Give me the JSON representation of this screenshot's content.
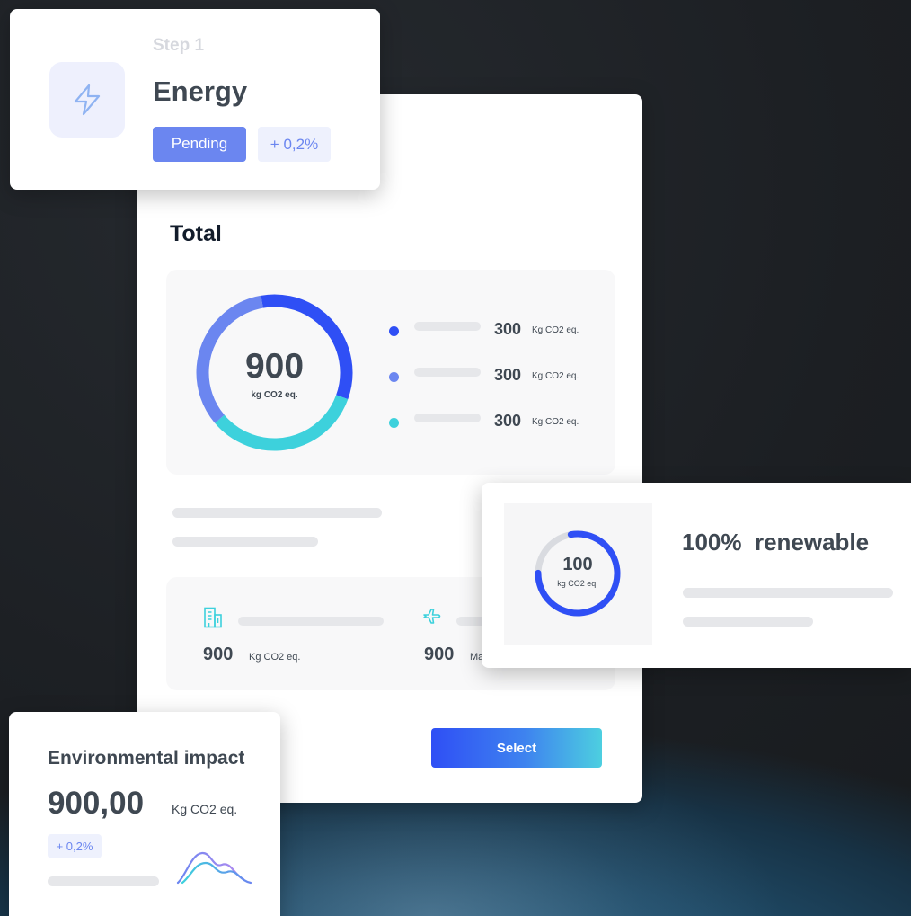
{
  "colors": {
    "accent_blue": "#2f4ff5",
    "periwinkle": "#6b86f0",
    "teal": "#3dd1dc",
    "text_dark": "#3f4852",
    "placeholder": "#e6e7ea"
  },
  "total_card": {
    "title": "Total",
    "donut": {
      "value": "900",
      "unit": "kg CO2 eq.",
      "segments": [
        {
          "share": 0.333,
          "color": "#2f4ff5"
        },
        {
          "share": 0.333,
          "color": "#3dd1dc"
        },
        {
          "share": 0.334,
          "color": "#6b86f0"
        }
      ]
    },
    "legend": [
      {
        "value": "300",
        "unit": "Kg CO2  eq.",
        "color": "#2f4ff5"
      },
      {
        "value": "300",
        "unit": "Kg CO2  eq.",
        "color": "#6b86f0"
      },
      {
        "value": "300",
        "unit": "Kg CO2  eq.",
        "color": "#3dd1dc"
      }
    ],
    "metrics": [
      {
        "icon": "building-icon",
        "value": "900",
        "unit": "Kg CO2 eq."
      },
      {
        "icon": "airplane-icon",
        "value": "900",
        "unit": "Ma"
      }
    ],
    "select_label": "Select"
  },
  "step_card": {
    "step_label": "Step 1",
    "title": "Energy",
    "icon": "lightning-icon",
    "status": "Pending",
    "delta": "+ 0,2%"
  },
  "renewable_card": {
    "gauge_value": "100",
    "gauge_unit": "kg CO2 eq.",
    "gauge_fill": 0.78,
    "title": "100%  renewable"
  },
  "impact_card": {
    "title": "Environmental impact",
    "value": "900,00",
    "unit": "Kg CO2 eq.",
    "delta": "+ 0,2%",
    "icon": "trend-waves-icon"
  }
}
